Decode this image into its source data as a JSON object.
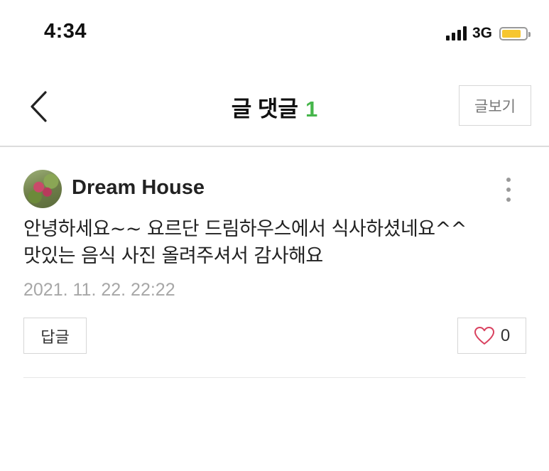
{
  "status_bar": {
    "time": "4:34",
    "network": "3G",
    "signal_bars": 4,
    "battery_color": "#f6c630"
  },
  "header": {
    "back_icon": "chevron-left-icon",
    "title": "글 댓글",
    "comment_count": "1",
    "count_color": "#46b64b",
    "view_post_label": "글보기"
  },
  "comment": {
    "author": "Dream House",
    "text_lines": [
      "안녕하세요~~ 요르단 드림하우스에서 식사하셨네요^^",
      "맛있는 음식 사진 올려주셔서 감사해요"
    ],
    "date": "2021. 11. 22. 22:22",
    "reply_label": "답글",
    "like_count": "0",
    "like_icon": "heart-outline-icon",
    "like_icon_color": "#d9415f",
    "more_icon": "more-vertical-icon"
  }
}
